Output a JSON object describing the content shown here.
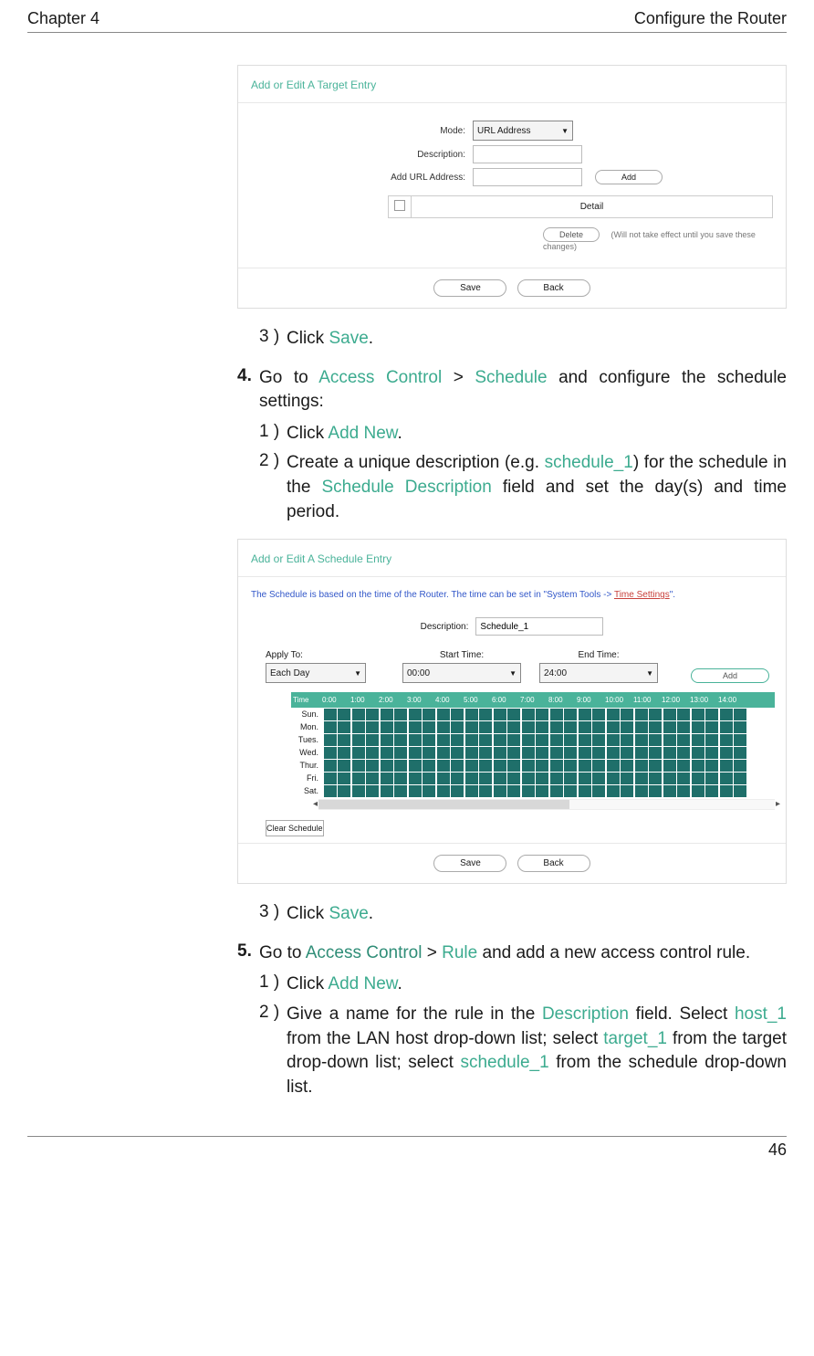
{
  "header": {
    "left": "Chapter 4",
    "right": "Configure the Router"
  },
  "footer": {
    "page": "46"
  },
  "target_panel": {
    "title": "Add or Edit A Target Entry",
    "mode_label": "Mode:",
    "mode_value": "URL Address",
    "desc_label": "Description:",
    "addurl_label": "Add URL Address:",
    "add_btn": "Add",
    "detail_col": "Detail",
    "delete_btn": "Delete",
    "delete_note": "(Will not take effect until you save these changes)",
    "save_btn": "Save",
    "back_btn": "Back"
  },
  "step3a": {
    "num": "3 )",
    "pre": "Click ",
    "link": "Save",
    "post": "."
  },
  "step4": {
    "num": "4.",
    "t1": "Go to ",
    "ac": "Access Control",
    "gt": " > ",
    "sched": "Schedule",
    "t2": " and configure the schedule settings:"
  },
  "s4_1": {
    "num": "1 )",
    "pre": "Click ",
    "link": "Add New",
    "post": "."
  },
  "s4_2": {
    "num": "2 )",
    "t1": "Create a unique description (e.g. ",
    "ex": "schedule_1",
    "t2": ") for the schedule in the ",
    "fld": "Schedule Description",
    "t3": " field and set the day(s) and time period."
  },
  "sched_panel": {
    "title": "Add or Edit A Schedule Entry",
    "info_pre": "The Schedule is based on the time of the Router. The time can be set in \"System Tools -> ",
    "info_link": "Time Settings",
    "info_post": "\".",
    "desc_label": "Description:",
    "desc_value": "Schedule_1",
    "apply_label": "Apply To:",
    "apply_value": "Each Day",
    "start_label": "Start Time:",
    "start_value": "00:00",
    "end_label": "End Time:",
    "end_value": "24:00",
    "add_btn": "Add",
    "time_col": "Time",
    "hours": [
      "0:00",
      "1:00",
      "2:00",
      "3:00",
      "4:00",
      "5:00",
      "6:00",
      "7:00",
      "8:00",
      "9:00",
      "10:00",
      "11:00",
      "12:00",
      "13:00",
      "14:00"
    ],
    "days": [
      "Sun.",
      "Mon.",
      "Tues.",
      "Wed.",
      "Thur.",
      "Fri.",
      "Sat."
    ],
    "clear_btn": "Clear Schedule",
    "save_btn": "Save",
    "back_btn": "Back"
  },
  "step3b": {
    "num": "3 )",
    "pre": "Click ",
    "link": "Save",
    "post": "."
  },
  "step5": {
    "num": "5.",
    "t1": "Go to ",
    "ac": "Access Control",
    "gt": " > ",
    "rule": "Rule",
    "t2": " and add a new access control rule."
  },
  "s5_1": {
    "num": "1 )",
    "pre": "Click ",
    "link": "Add New",
    "post": "."
  },
  "s5_2": {
    "num": "2 )",
    "t1": "Give a name for the rule in the ",
    "desc": "Description",
    "t2": " field. Select ",
    "host": "host_1",
    "t3": " from the LAN host drop-down list; select ",
    "target": "target_1",
    "t4": " from the target drop-down list; select ",
    "sched": "schedule_1",
    "t5": " from the schedule drop-down list."
  }
}
